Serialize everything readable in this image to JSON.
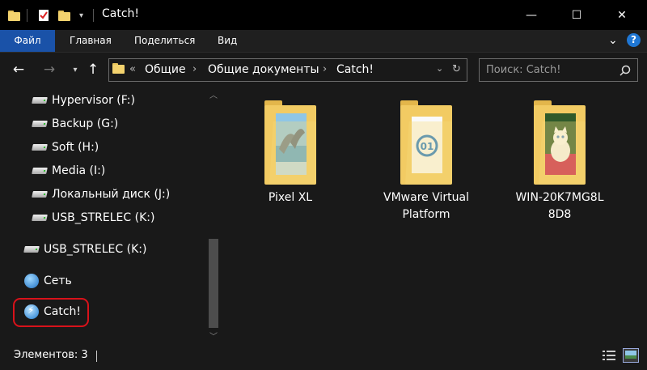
{
  "window": {
    "title": "Catch!",
    "controls": {
      "minimize": "—",
      "maximize": "☐",
      "close": "✕"
    }
  },
  "ribbon": {
    "tabs": [
      "Файл",
      "Главная",
      "Поделиться",
      "Вид"
    ]
  },
  "address": {
    "prefix": "«",
    "segments": [
      "Общие",
      "Общие документы",
      "Catch!"
    ]
  },
  "search": {
    "placeholder": "Поиск: Catch!"
  },
  "sidebar": {
    "drives": [
      "Hypervisor (F:)",
      "Backup (G:)",
      "Soft (H:)",
      "Media (I:)",
      "Локальный диск (J:)",
      "USB_STRELEC (K:)"
    ],
    "usb_root": "USB_STRELEC (K:)",
    "network": "Сеть",
    "catch": "Catch!"
  },
  "content": {
    "items": [
      {
        "line1": "Pixel XL",
        "line2": ""
      },
      {
        "line1": "VMware Virtual",
        "line2": "Platform"
      },
      {
        "line1": "WIN-20K7MG8L",
        "line2": "8D8"
      }
    ]
  },
  "status": {
    "count_text": "Элементов: 3"
  },
  "colors": {
    "file_tab": "#1a52a8",
    "highlight": "#d8121a",
    "folder": "#f2cb63"
  }
}
